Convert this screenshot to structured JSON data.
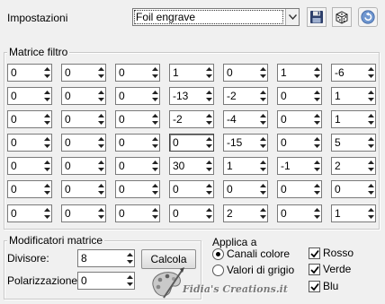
{
  "settings": {
    "label": "Impostazioni",
    "preset": "Foil engrave",
    "save_icon": "floppy-disk-icon",
    "random_icon": "dice-icon",
    "reset_icon": "undo-icon"
  },
  "matrix": {
    "title": "Matrice filtro",
    "rows": [
      [
        "0",
        "0",
        "0",
        "1",
        "0",
        "1",
        "-6"
      ],
      [
        "0",
        "0",
        "0",
        "-13",
        "-2",
        "0",
        "1"
      ],
      [
        "0",
        "0",
        "0",
        "-2",
        "-4",
        "0",
        "1"
      ],
      [
        "0",
        "0",
        "0",
        "0",
        "-15",
        "0",
        "5"
      ],
      [
        "0",
        "0",
        "0",
        "30",
        "1",
        "-1",
        "2"
      ],
      [
        "0",
        "0",
        "0",
        "0",
        "0",
        "0",
        "0"
      ],
      [
        "0",
        "0",
        "0",
        "0",
        "2",
        "0",
        "1"
      ]
    ]
  },
  "modifiers": {
    "title": "Modificatori matrice",
    "divisor_label": "Divisore:",
    "divisor": "8",
    "bias_label": "Polarizzazione:",
    "bias": "0",
    "calc_label": "Calcola"
  },
  "apply": {
    "title": "Applica a",
    "option_color": "Canali colore",
    "option_gray": "Valori di grigio",
    "selected": "Canali colore",
    "red": "Rosso",
    "green": "Verde",
    "blue": "Blu",
    "red_checked": true,
    "green_checked": true,
    "blue_checked": true
  },
  "watermark": "Fidia's Creations.it"
}
